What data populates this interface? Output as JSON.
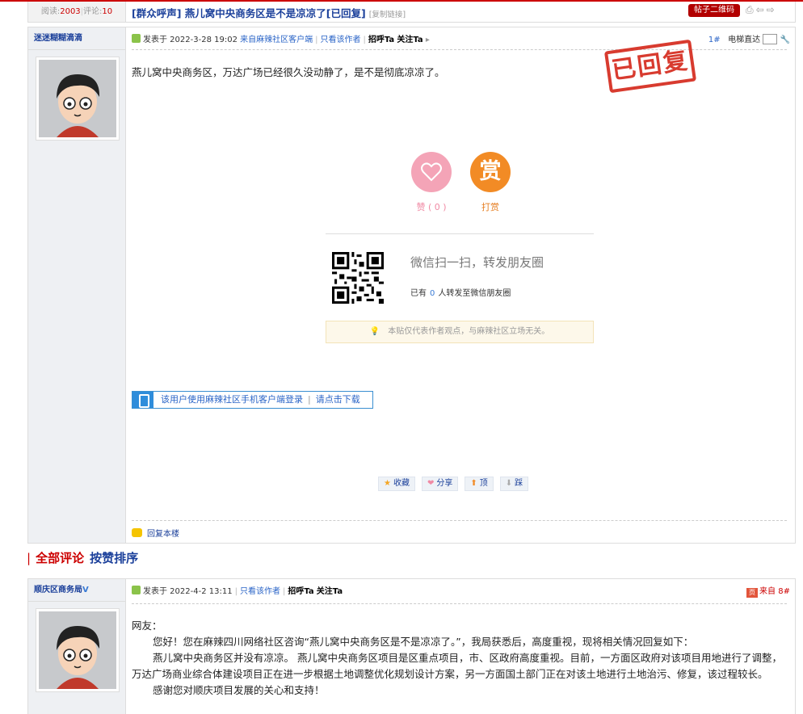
{
  "thread": {
    "views_label": "阅读:",
    "views": "2003",
    "comments_label": "评论:",
    "comments": "10",
    "title": "[群众呼声] 燕儿窝中央商务区是不是凉凉了[已回复]",
    "copy_link": "[复制链接]",
    "qr_button": "帖子二维码"
  },
  "first_post": {
    "author": "迷迷糊糊滴滴",
    "posted": "发表于 2022-3-28 19:02",
    "source": "来自麻辣社区客户端",
    "only_author": "只看该作者",
    "greet": "招呼Ta",
    "follow": "关注Ta",
    "floor": "1",
    "floor_mark": "#",
    "jump_label": "电梯直达",
    "stamp": "已回复",
    "content": "燕儿窝中央商务区，万达广场已经很久没动静了，是不是彻底凉凉了。",
    "like_label": "赞 ( 0 )",
    "reward_char": "赏",
    "reward_label": "打赏",
    "wechat_title": "微信扫一扫，转发朋友圈",
    "wechat_pre": "已有",
    "wechat_count": "0",
    "wechat_post": "人转发至微信朋友圈",
    "disclaimer": "本贴仅代表作者观点，与麻辣社区立场无关。",
    "app_text": "该用户使用麻辣社区手机客户端登录",
    "app_sep": "|",
    "app_link": "请点击下载",
    "actions": {
      "collect": "收藏",
      "share": "分享",
      "up": "顶",
      "down": "踩"
    },
    "reply_floor": "回复本楼"
  },
  "comments_header": {
    "all": "全部评论",
    "sort": "按赞排序"
  },
  "reply": {
    "author": "顺庆区商务局",
    "verified": "V",
    "posted": "发表于 2022-4-2 13:11",
    "only_author": "只看该作者",
    "greet": "招呼Ta",
    "follow": "关注Ta",
    "source": "来自",
    "floor": "8",
    "floor_mark": "#",
    "source_tag": "页",
    "lines": [
      "网友：",
      "您好！您在麻辣四川网络社区咨询“燕儿窝中央商务区是不是凉凉了。”，我局获悉后，高度重视，现将相关情况回复如下：",
      "燕儿窝中央商务区并没有凉凉。 燕儿窝中央商务区项目是区重点项目，市、区政府高度重视。目前，一方面区政府对该项目用地进行了调整，万达广场商业综合体建设项目正在进一步根据土地调整优化规划设计方案，另一方面国土部门正在对该土地进行土地治污、修复，该过程较长。",
      "感谢您对顺庆项目发展的关心和支持！"
    ]
  },
  "colors": {
    "accent_red": "#c00000",
    "link_blue": "#1a3f9a",
    "like_pink": "#f4a4b7",
    "reward_orange": "#f28b25"
  }
}
